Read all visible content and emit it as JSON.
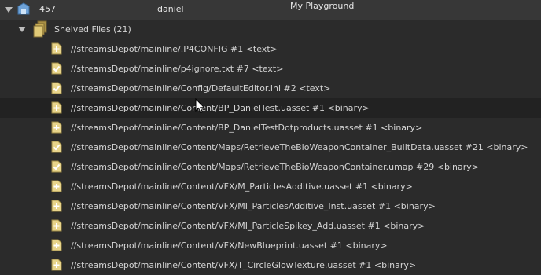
{
  "changelist": {
    "number": "457",
    "user": "daniel",
    "workspace": "My Playground"
  },
  "shelved": {
    "label": "Shelved Files (21)"
  },
  "files": [
    {
      "path": "//streamsDepot/mainline/.P4CONFIG #1 <text>",
      "action": "add"
    },
    {
      "path": "//streamsDepot/mainline/p4ignore.txt #7 <text>",
      "action": "edit"
    },
    {
      "path": "//streamsDepot/mainline/Config/DefaultEditor.ini #2 <text>",
      "action": "edit"
    },
    {
      "path": "//streamsDepot/mainline/Content/BP_DanielTest.uasset #1 <binary>",
      "action": "add"
    },
    {
      "path": "//streamsDepot/mainline/Content/BP_DanielTestDotproducts.uasset #1 <binary>",
      "action": "add"
    },
    {
      "path": "//streamsDepot/mainline/Content/Maps/RetrieveTheBioWeaponContainer_BuiltData.uasset #21 <binary>",
      "action": "edit"
    },
    {
      "path": "//streamsDepot/mainline/Content/Maps/RetrieveTheBioWeaponContainer.umap #29 <binary>",
      "action": "edit"
    },
    {
      "path": "//streamsDepot/mainline/Content/VFX/M_ParticlesAdditive.uasset #1 <binary>",
      "action": "add"
    },
    {
      "path": "//streamsDepot/mainline/Content/VFX/MI_ParticlesAdditive_Inst.uasset #1 <binary>",
      "action": "add"
    },
    {
      "path": "//streamsDepot/mainline/Content/VFX/MI_ParticleSpikey_Add.uasset #1 <binary>",
      "action": "add"
    },
    {
      "path": "//streamsDepot/mainline/Content/VFX/NewBlueprint.uasset #1 <binary>",
      "action": "add"
    },
    {
      "path": "//streamsDepot/mainline/Content/VFX/T_CircleGlowTexture.uasset #1 <binary>",
      "action": "add"
    }
  ],
  "colors": {
    "background": "#2b2b2b",
    "header_row": "#373737",
    "row_highlight": "#222222",
    "file_icon": "#e8d48a",
    "folder_icon": "#c8ad56",
    "changelist_icon": "#6fa3d8"
  }
}
